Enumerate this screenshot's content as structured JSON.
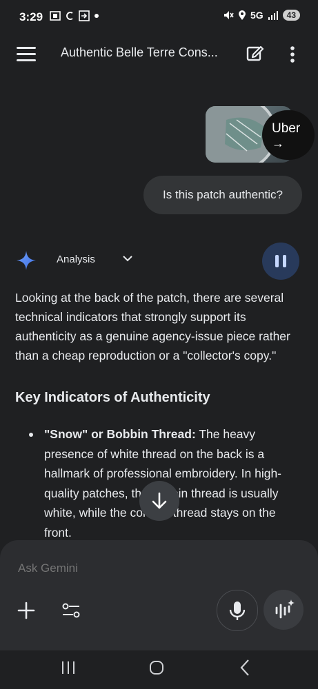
{
  "status_bar": {
    "time": "3:29",
    "network": "5G",
    "battery": "43"
  },
  "app_bar": {
    "title": "Authentic Belle Terre Cons..."
  },
  "attachment": {
    "chip_label": "Uber",
    "chip_arrow": "→"
  },
  "user_message": "Is this patch authentic?",
  "response": {
    "mode_label": "Analysis",
    "paragraph": "Looking at the back of the patch, there are several technical indicators that strongly support its authenticity as a genuine agency-issue piece rather than a cheap reproduction or a \"collector's copy.\"",
    "heading": "Key Indicators of Authenticity",
    "bullets": [
      {
        "title": "\"Snow\" or Bobbin Thread:",
        "body": " The heavy presence of white thread on the back is a hallmark of professional embroidery. In high-quality patches, the bobbin thread is usually white, while the colored thread stays on the front."
      }
    ]
  },
  "composer": {
    "placeholder": "Ask Gemini"
  },
  "icons": {
    "menu": "menu-icon",
    "edit": "edit-icon",
    "more": "more-vert-icon",
    "gemini": "gemini-star-icon",
    "chevron": "chevron-down-icon",
    "pause": "pause-icon",
    "scroll": "arrow-down-icon",
    "plus": "plus-icon",
    "tools": "tune-icon",
    "mic": "mic-icon",
    "live": "gemini-live-icon"
  },
  "colors": {
    "background": "#1f2022",
    "accent": "#4c8df6",
    "pause_bg": "#283a5b"
  }
}
